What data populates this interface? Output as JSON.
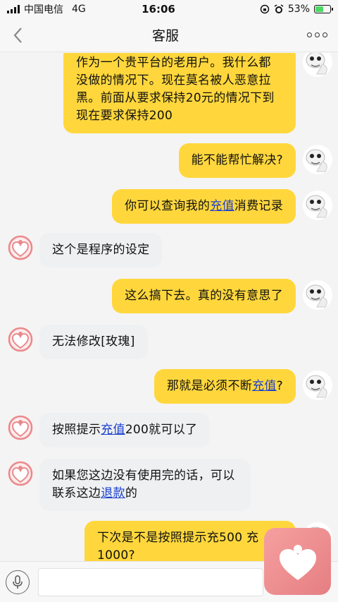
{
  "status_bar": {
    "carrier": "中国电信",
    "network": "4G",
    "time": "16:06",
    "battery": "53%",
    "battery_level": 0.53
  },
  "nav": {
    "title": "客服",
    "back_icon": "chevron-left-icon",
    "more_icon": "more-dots-icon"
  },
  "messages": [
    {
      "side": "right",
      "parts": [
        {
          "t": "作为一个贵平台的老用户。我什么都没做的情况下。现在莫名被人恶意拉黑。前面从要求保持20元的情况下到现在要求保持200"
        }
      ]
    },
    {
      "side": "right",
      "parts": [
        {
          "t": "能不能帮忙解决?"
        }
      ]
    },
    {
      "side": "right",
      "parts": [
        {
          "t": "你可以查询我的"
        },
        {
          "t": "充值",
          "link": true
        },
        {
          "t": "消费记录"
        }
      ]
    },
    {
      "side": "left",
      "parts": [
        {
          "t": "这个是程序的设定"
        }
      ]
    },
    {
      "side": "right",
      "parts": [
        {
          "t": "这么搞下去。真的没有意思了"
        }
      ]
    },
    {
      "side": "left",
      "parts": [
        {
          "t": "无法修改[玫瑰]"
        }
      ]
    },
    {
      "side": "right",
      "parts": [
        {
          "t": "那就是必须不断"
        },
        {
          "t": "充值",
          "link": true
        },
        {
          "t": "?"
        }
      ]
    },
    {
      "side": "left",
      "parts": [
        {
          "t": "按照提示"
        },
        {
          "t": "充值",
          "link": true
        },
        {
          "t": "200就可以了"
        }
      ]
    },
    {
      "side": "left",
      "parts": [
        {
          "t": "如果您这边没有使用完的话，可以联系这边"
        },
        {
          "t": "退款",
          "link": true
        },
        {
          "t": "的"
        }
      ]
    },
    {
      "side": "right",
      "parts": [
        {
          "t": "下次是不是按照提示充500 充1000?"
        }
      ]
    }
  ],
  "input": {
    "placeholder": "",
    "voice_icon": "microphone-icon"
  },
  "colors": {
    "user_bubble": "#ffd73c",
    "agent_bubble": "#eef0f2",
    "link": "#1b3fce",
    "agent_avatar": "#e88a8d"
  }
}
